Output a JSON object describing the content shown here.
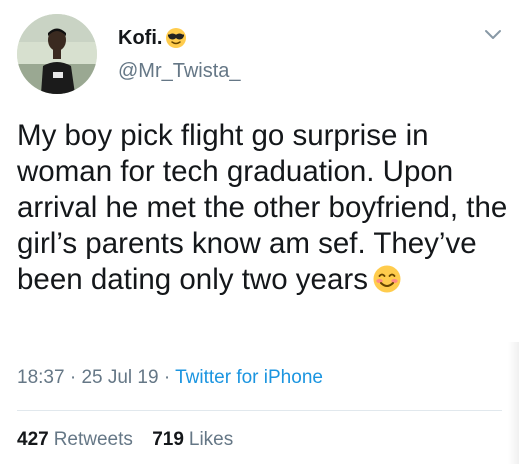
{
  "author": {
    "name": "Kofi.",
    "name_emoji_icon": "sunglasses-face-icon",
    "handle": "@Mr_Twista_",
    "avatar_icon": "avatar-photo"
  },
  "tweet": {
    "text": "My boy pick flight go surprise in woman for tech graduation. Upon arrival he met the other boyfriend, the girl’s parents know am sef. They’ve been dating only two years",
    "text_emoji_icon": "smiling-face-blushing-icon"
  },
  "meta": {
    "time": "18:37",
    "separator": "·",
    "date": "25 Jul 19",
    "source": "Twitter for iPhone"
  },
  "stats": {
    "retweets_count": "427",
    "retweets_label": "Retweets",
    "likes_count": "719",
    "likes_label": "Likes"
  },
  "menu_icon": "chevron-down-icon",
  "colors": {
    "text": "#14171a",
    "secondary": "#657786",
    "link": "#1b95e0",
    "divider": "#e1e8ed"
  }
}
